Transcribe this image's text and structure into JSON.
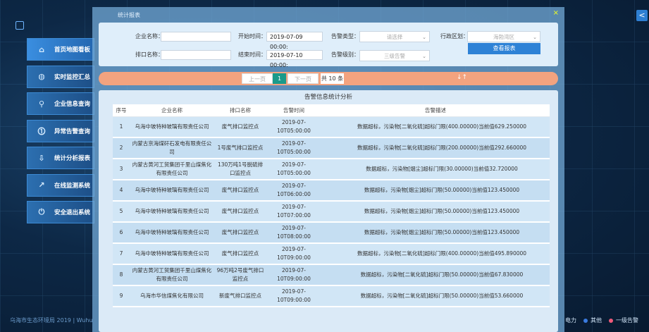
{
  "sidebar": {
    "items": [
      {
        "label": "首页地图看板",
        "icon": "home-icon"
      },
      {
        "label": "实时监控汇总",
        "icon": "globe-icon"
      },
      {
        "label": "企业信息查询",
        "icon": "search-icon"
      },
      {
        "label": "异常告警查询",
        "icon": "alert-icon"
      },
      {
        "label": "统计分析报表",
        "icon": "download-icon"
      },
      {
        "label": "在线监测系统",
        "icon": "chart-icon"
      },
      {
        "label": "安全退出系统",
        "icon": "power-icon"
      }
    ]
  },
  "footer": {
    "copyright": "乌海市生态环境局 2019 | Wuhu",
    "legend": [
      {
        "label": "电力",
        "color": ""
      },
      {
        "label": "其他",
        "color": "#3a7be0"
      },
      {
        "label": "一级告警",
        "color": "#f05a7a"
      }
    ]
  },
  "modal": {
    "title": "统计报表",
    "close": "×"
  },
  "filters": {
    "company_label": "企业名称：",
    "company_value": "",
    "outlet_label": "排口名称：",
    "outlet_value": "",
    "start_label": "开始时间：",
    "start_value": "2019-07-09 00:00:",
    "end_label": "结束时间：",
    "end_value": "2019-07-10 00:00:",
    "alarm_type_label": "告警类型：",
    "alarm_type_value": "请选择",
    "alarm_level_label": "告警级别：",
    "alarm_level_value": "三级告警",
    "region_label": "行政区划：",
    "region_value": "海勃湾区",
    "report_button": "查看报表"
  },
  "pager": {
    "prev": "上一页",
    "page": "1",
    "next": "下一页",
    "total": "共 10 条",
    "sort_glyph": "↓↑"
  },
  "table": {
    "title": "告警信息统计分析",
    "headers": [
      "序号",
      "企业名称",
      "排口名称",
      "告警时间",
      "告警描述"
    ],
    "rows": [
      [
        "1",
        "乌海中玻特种玻璃有限责任公司",
        "废气排口监控点",
        "2019-07-10T05:00:00",
        "数据超标，污染物[二氧化硫]超标门限(400.00000)当前值629.250000"
      ],
      [
        "2",
        "内蒙古京海煤矸石发电有限责任公司",
        "1号废气排口监控点",
        "2019-07-10T05:00:00",
        "数据超标，污染物[二氧化硫]超标门限(200.00000)当前值292.660000"
      ],
      [
        "3",
        "内蒙古黄河工贸集团千里山煤焦化有限责任公司",
        "130万吨1号脱硫排口监控点",
        "2019-07-10T05:00:00",
        "数据超标，污染物[烟尘]超标门限(30.00000)当前值32.720000"
      ],
      [
        "4",
        "乌海中玻特种玻璃有限责任公司",
        "废气排口监控点",
        "2019-07-10T06:00:00",
        "数据超标，污染物[烟尘]超标门限(50.00000)当前值123.450000"
      ],
      [
        "5",
        "乌海中玻特种玻璃有限责任公司",
        "废气排口监控点",
        "2019-07-10T07:00:00",
        "数据超标，污染物[烟尘]超标门限(50.00000)当前值123.450000"
      ],
      [
        "6",
        "乌海中玻特种玻璃有限责任公司",
        "废气排口监控点",
        "2019-07-10T08:00:00",
        "数据超标，污染物[烟尘]超标门限(50.00000)当前值123.450000"
      ],
      [
        "7",
        "乌海中玻特种玻璃有限责任公司",
        "废气排口监控点",
        "2019-07-10T09:00:00",
        "数据超标，污染物[二氧化硫]超标门限(400.00000)当前值495.890000"
      ],
      [
        "8",
        "内蒙古黄河工贸集团千里山煤焦化有限责任公司",
        "96万吨2号废气排口监控点",
        "2019-07-10T09:00:00",
        "数据超标，污染物[二氧化硫]超标门限(50.00000)当前值67.830000"
      ],
      [
        "9",
        "乌海市华信煤焦化有限公司",
        "新废气排口监控点",
        "2019-07-10T09:00:00",
        "数据超标，污染物[二氧化硫]超标门限(50.00000)当前值53.660000"
      ]
    ]
  },
  "top_toggle": "<"
}
